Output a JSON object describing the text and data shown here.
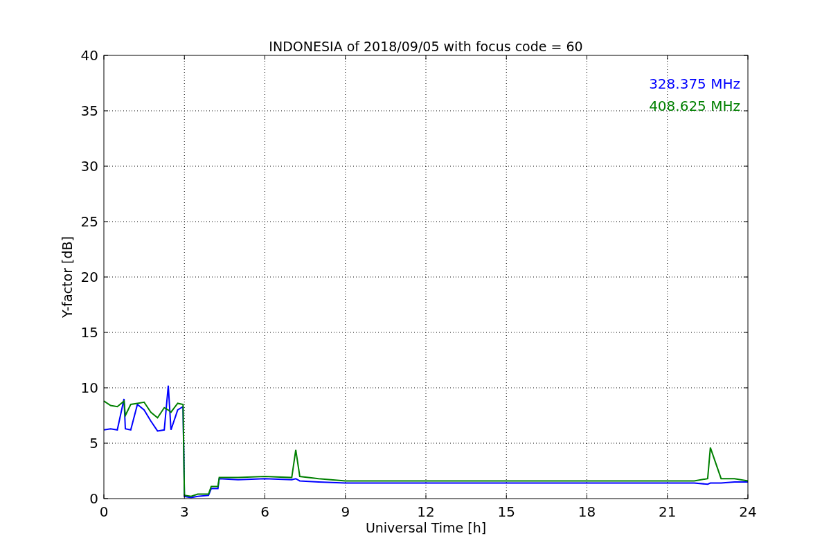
{
  "chart_data": {
    "type": "line",
    "title": "INDONESIA of 2018/09/05 with focus code = 60",
    "xlabel": "Universal Time [h]",
    "ylabel": "Y-factor [dB]",
    "x": [
      0,
      0.25,
      0.5,
      0.75,
      0.8,
      1.0,
      1.25,
      1.5,
      1.75,
      2.0,
      2.25,
      2.4,
      2.5,
      2.75,
      2.95,
      3.0,
      3.25,
      3.5,
      3.9,
      4.0,
      4.25,
      4.3,
      5,
      6,
      7,
      7.15,
      7.3,
      8,
      9,
      22,
      22.5,
      22.6,
      23,
      23.5,
      24
    ],
    "series": [
      {
        "name": "328.375 MHz",
        "color": "#0000ff",
        "values": [
          6.2,
          6.3,
          6.2,
          9.0,
          6.3,
          6.2,
          8.5,
          8.0,
          7.0,
          6.1,
          6.2,
          10.2,
          6.2,
          8.0,
          8.3,
          0.2,
          0.1,
          0.2,
          0.3,
          0.9,
          0.9,
          1.8,
          1.7,
          1.8,
          1.7,
          1.8,
          1.6,
          1.5,
          1.4,
          1.4,
          1.3,
          1.4,
          1.4,
          1.5,
          1.5
        ]
      },
      {
        "name": "408.625 MHz",
        "color": "#008000",
        "values": [
          8.8,
          8.4,
          8.3,
          8.8,
          7.5,
          8.5,
          8.6,
          8.7,
          7.8,
          7.3,
          8.2,
          8.0,
          7.8,
          8.6,
          8.5,
          0.3,
          0.2,
          0.4,
          0.4,
          1.1,
          1.1,
          1.9,
          1.9,
          2.0,
          1.9,
          4.4,
          2.0,
          1.8,
          1.6,
          1.6,
          1.8,
          4.6,
          1.8,
          1.8,
          1.6
        ]
      }
    ],
    "grid": true,
    "xlim": [
      0,
      24
    ],
    "ylim": [
      0,
      40
    ],
    "xticks": [
      0,
      3,
      6,
      9,
      12,
      15,
      18,
      21,
      24
    ],
    "yticks": [
      0,
      5,
      10,
      15,
      20,
      25,
      30,
      35,
      40
    ]
  }
}
